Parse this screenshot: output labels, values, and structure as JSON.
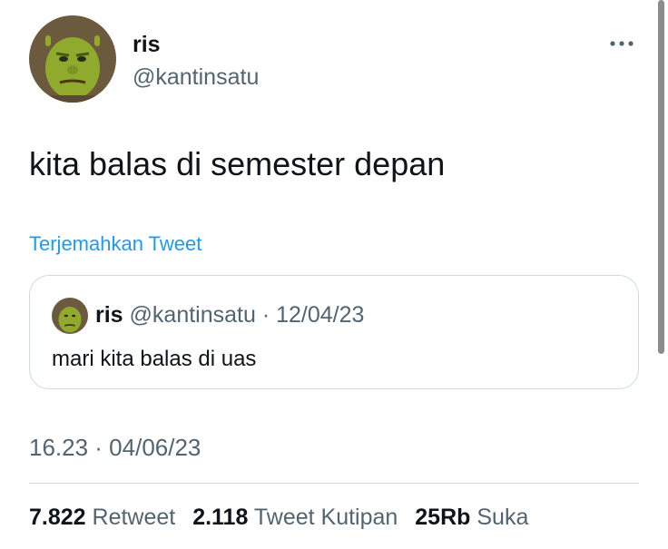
{
  "author": {
    "display_name": "ris",
    "handle": "@kantinsatu",
    "avatar_icon": "shrek-avatar"
  },
  "tweet": {
    "text": "kita balas di semester depan",
    "translate_label": "Terjemahkan Tweet",
    "timestamp": "16.23 · 04/06/23"
  },
  "quote": {
    "display_name": "ris",
    "handle": "@kantinsatu",
    "separator": "·",
    "date": "12/04/23",
    "text": "mari kita balas di uas"
  },
  "stats": {
    "retweets": {
      "count": "7.822",
      "label": "Retweet"
    },
    "quotes": {
      "count": "2.118",
      "label": "Tweet Kutipan"
    },
    "likes": {
      "count": "25Rb",
      "label": "Suka"
    }
  },
  "colors": {
    "link": "#1d9bf0",
    "secondary_text": "#536471",
    "primary_text": "#0f1419",
    "border": "#cfd9de"
  },
  "icons": {
    "more": "more-horizontal-icon"
  }
}
